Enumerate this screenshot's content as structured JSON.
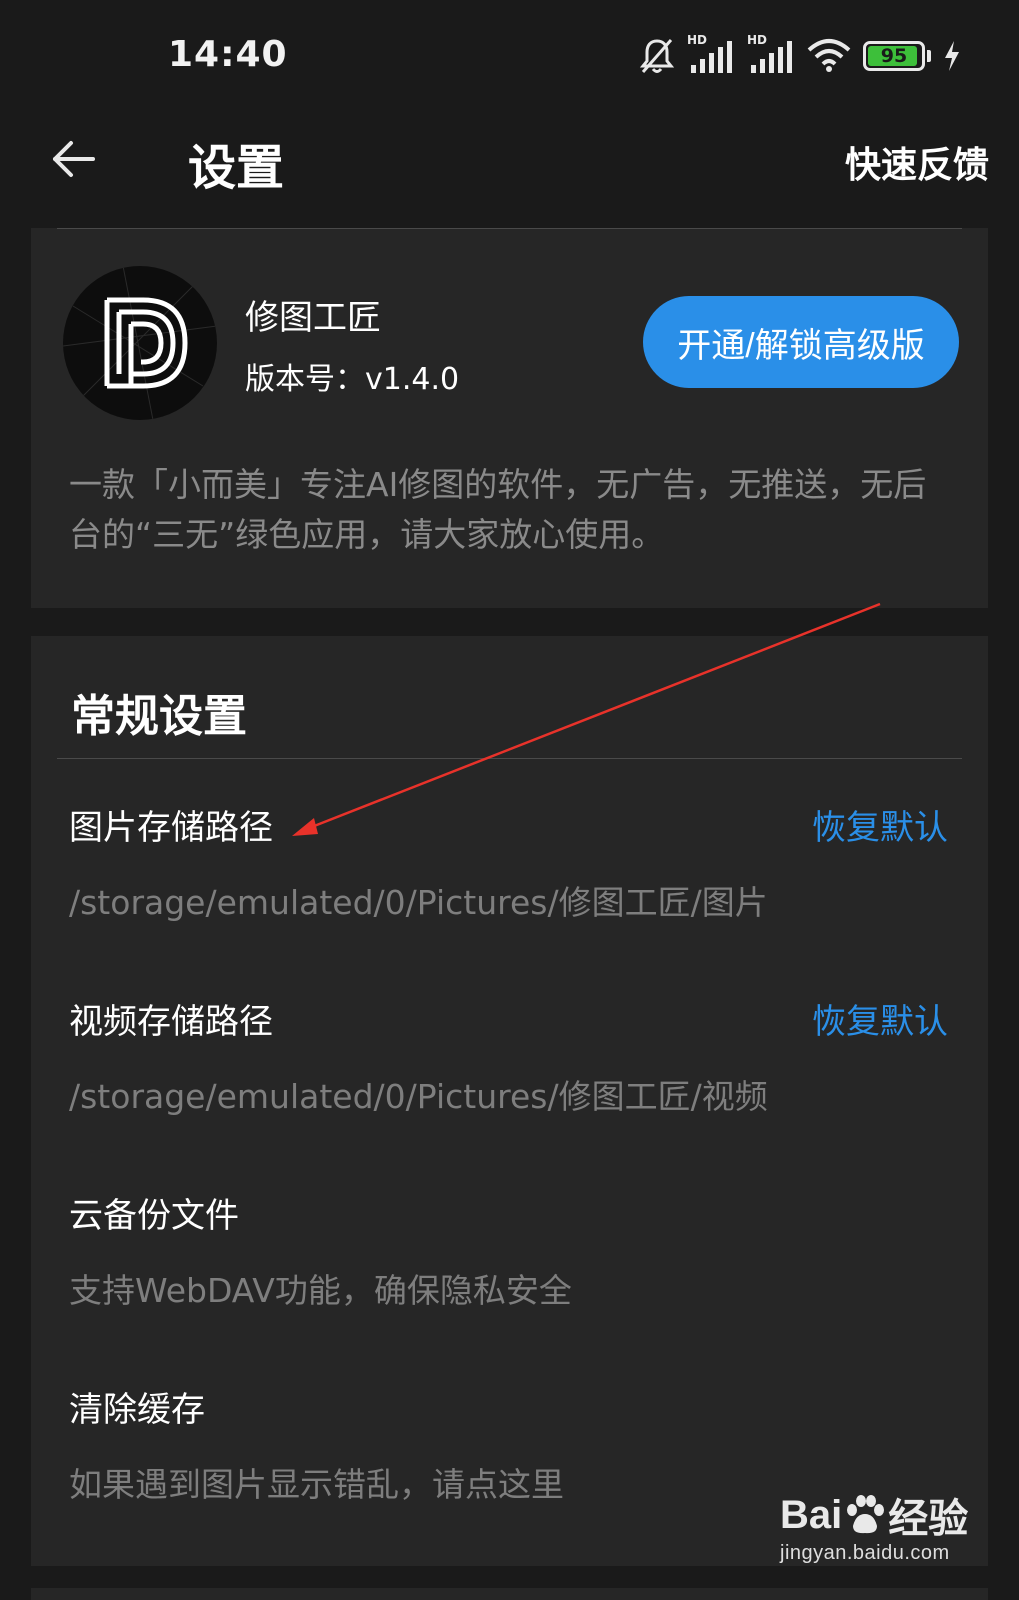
{
  "status_bar": {
    "time": "14:40",
    "battery": "95",
    "battery_level": 0.95,
    "icons": [
      "bell-mute-icon",
      "signal-hd-icon",
      "signal-hd-icon",
      "wifi-icon",
      "battery-icon",
      "charging-icon"
    ],
    "hd_label": "HD"
  },
  "header": {
    "back_icon": "arrow-left-icon",
    "title": "设置",
    "feedback": "快速反馈"
  },
  "app_card": {
    "logo_icon": "app-logo-icon",
    "name": "修图工匠",
    "version": "版本号：v1.4.0",
    "unlock_button": "开通/解锁高级版",
    "description": "一款「小而美」专注AI修图的软件，无广告，无推送，无后台的“三无”绿色应用，请大家放心使用。"
  },
  "general_settings": {
    "title": "常规设置",
    "items": [
      {
        "label": "图片存储路径",
        "action": "恢复默认",
        "value": "/storage/emulated/0/Pictures/修图工匠/图片"
      },
      {
        "label": "视频存储路径",
        "action": "恢复默认",
        "value": "/storage/emulated/0/Pictures/修图工匠/视频"
      },
      {
        "label": "云备份文件",
        "value": "支持WebDAV功能，确保隐私安全"
      },
      {
        "label": "清除缓存",
        "value": "如果遇到图片显示错乱，请点这里"
      }
    ]
  },
  "watermark": {
    "logo_left": "Bai",
    "logo_right": "经验",
    "url": "jingyan.baidu.com"
  },
  "colors": {
    "accent": "#2a8fe8",
    "annotation": "#e8322a",
    "background": "#1a1a1a",
    "card": "#262626"
  }
}
